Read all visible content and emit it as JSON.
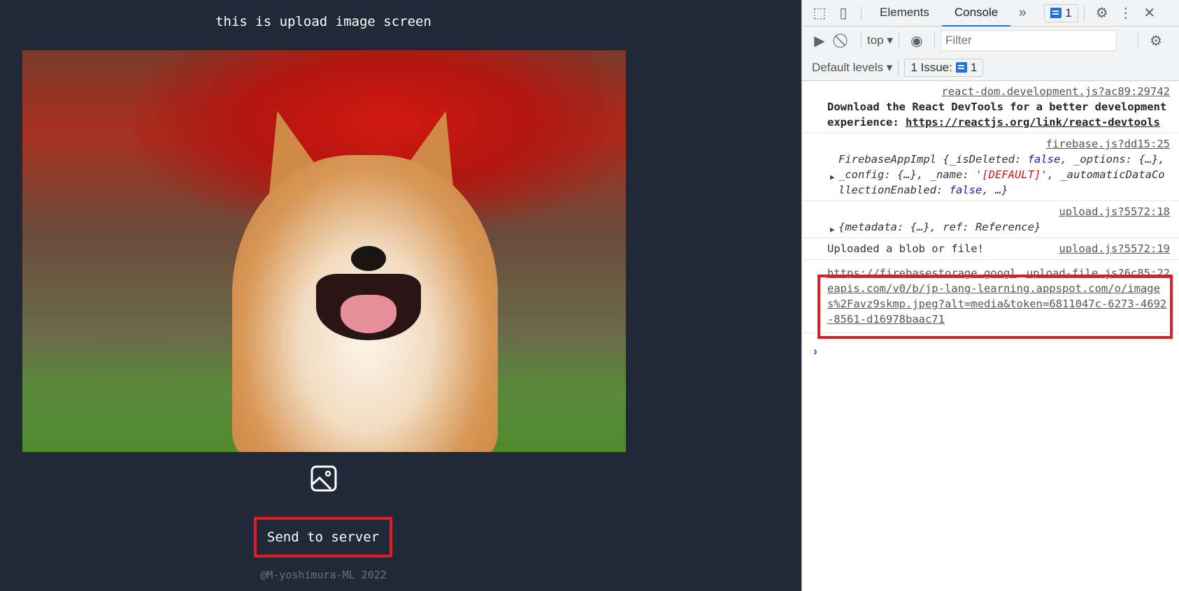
{
  "app": {
    "title": "this is upload image screen",
    "send_label": "Send to server",
    "footer": "@M-yoshimura-ML 2022"
  },
  "devtools": {
    "tabs": [
      "Elements",
      "Console"
    ],
    "more": "»",
    "issues_badge": "1",
    "context": "top",
    "filter_placeholder": "Filter",
    "levels": "Default levels",
    "issue_label": "1 Issue:",
    "issue_count": "1",
    "messages": [
      {
        "source": "react-dom.development.js?ac89:29742",
        "text": "Download the React DevTools for a better development experience: ",
        "link": "https://reactjs.org/link/react-devtools"
      },
      {
        "source": "firebase.js?dd15:25",
        "obj_name": "FirebaseAppImpl",
        "p1": "{_isDeleted: ",
        "v1": "false",
        "p2": ", _options: {…}, _config: {…}, _name: ",
        "v2": "'[DEFAULT]'",
        "p3": ", _automaticDataCollectionEnabled: ",
        "v3": "false",
        "p4": ", …}"
      },
      {
        "source": "upload.js?5572:18",
        "text": "{metadata: {…}, ref: Reference}"
      },
      {
        "source": "upload.js?5572:19",
        "text": "Uploaded a blob or file!"
      },
      {
        "source": "upload-file.js?6c85:22",
        "link": "https://firebasestorage.googleapis.com/v0/b/jp-lang-learning.appspot.com/o/images%2Favz9skmp.jpeg?alt=media&token=6811047c-6273-4692-8561-d16978baac71"
      }
    ],
    "prompt": "›"
  }
}
